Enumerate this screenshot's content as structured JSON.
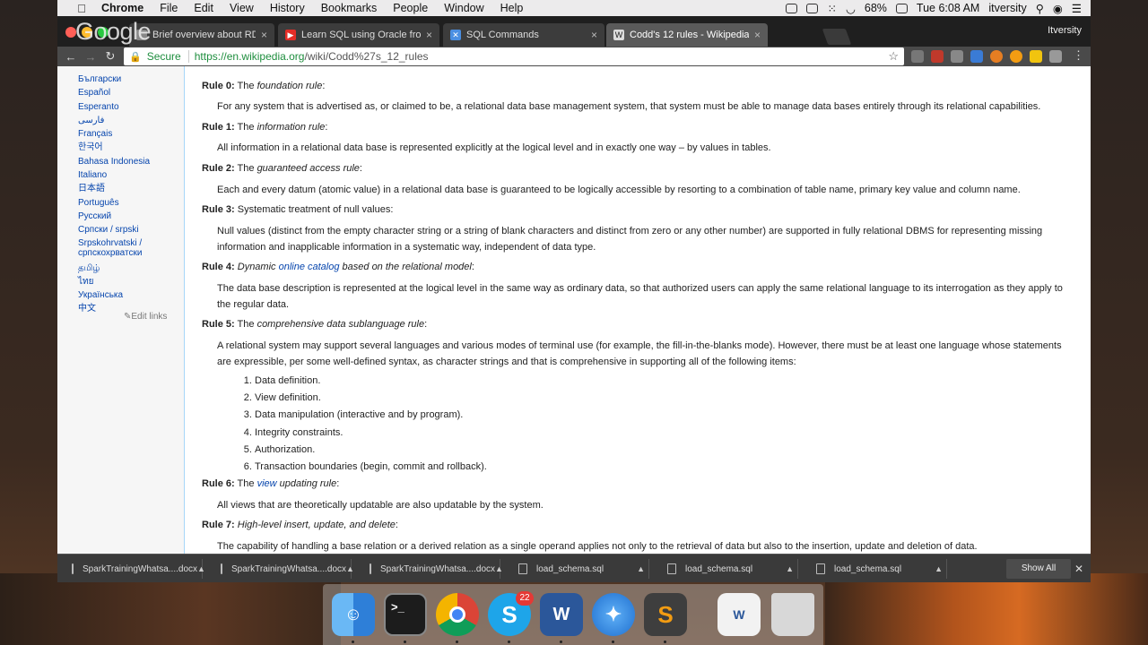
{
  "menubar": {
    "app": "Chrome",
    "items": [
      "File",
      "Edit",
      "View",
      "History",
      "Bookmarks",
      "People",
      "Window",
      "Help"
    ],
    "battery": "68%",
    "clock": "Tue 6:08 AM",
    "user": "itversity"
  },
  "browser": {
    "logo": "Google",
    "profile": "Itversity",
    "tabs": [
      {
        "label": "Brief overview about RDBMS,",
        "icon": "document-icon",
        "color": "#888888"
      },
      {
        "label": "Learn SQL using Oracle from c",
        "icon": "youtube-icon",
        "color": "#e52d27"
      },
      {
        "label": "SQL Commands",
        "icon": "tool-icon",
        "color": "#4a8fe2"
      },
      {
        "label": "Codd's 12 rules - Wikipedia",
        "icon": "wikipedia-icon",
        "color": "#dddddd"
      }
    ],
    "secure_label": "Secure",
    "url_host": "https://en.wikipedia.org",
    "url_path": "/wiki/Codd%27s_12_rules"
  },
  "sidebar": {
    "languages": [
      "Български",
      "Español",
      "Esperanto",
      "فارسی",
      "Français",
      "한국어",
      "Bahasa Indonesia",
      "Italiano",
      "日本語",
      "Português",
      "Русский",
      "Српски / srpski",
      "Srpskohrvatski / српскохрватски",
      "தமிழ்",
      "ไทย",
      "Українська",
      "中文"
    ],
    "edit_links": "Edit links"
  },
  "content": {
    "rule0": {
      "num": "Rule 0:",
      "pre": "The ",
      "name": "foundation rule",
      "post": ":",
      "desc": "For any system that is advertised as, or claimed to be, a relational data base management system, that system must be able to manage data bases entirely through its relational capabilities."
    },
    "rule1": {
      "num": "Rule 1:",
      "pre": "The ",
      "name": "information rule",
      "post": ":",
      "desc": "All information in a relational data base is represented explicitly at the logical level and in exactly one way – by values in tables."
    },
    "rule2": {
      "num": "Rule 2:",
      "pre": "The ",
      "name": "guaranteed access rule",
      "post": ":",
      "desc": "Each and every datum (atomic value) in a relational data base is guaranteed to be logically accessible by resorting to a combination of table name, primary key value and column name."
    },
    "rule3": {
      "num": "Rule 3:",
      "text": "Systematic treatment of null values:",
      "desc": "Null values (distinct from the empty character string or a string of blank characters and distinct from zero or any other number) are supported in fully relational DBMS for representing missing information and inapplicable information in a systematic way, independent of data type."
    },
    "rule4": {
      "num": "Rule 4:",
      "pre": "Dynamic ",
      "link": "online catalog",
      "post": " based on the relational model",
      "desc": "The data base description is represented at the logical level in the same way as ordinary data, so that authorized users can apply the same relational language to its interrogation as they apply to the regular data."
    },
    "rule5": {
      "num": "Rule 5:",
      "pre": "The ",
      "name": "comprehensive data sublanguage rule",
      "post": ":",
      "desc": "A relational system may support several languages and various modes of terminal use (for example, the fill-in-the-blanks mode). However, there must be at least one language whose statements are expressible, per some well-defined syntax, as character strings and that is comprehensive in supporting all of the following items:",
      "items": [
        "Data definition.",
        "View definition.",
        "Data manipulation (interactive and by program).",
        "Integrity constraints.",
        "Authorization.",
        "Transaction boundaries (begin, commit and rollback)."
      ]
    },
    "rule6": {
      "num": "Rule 6:",
      "pre": "The ",
      "link": "view",
      "name": " updating rule",
      "post": ":",
      "desc": "All views that are theoretically updatable are also updatable by the system."
    },
    "rule7": {
      "num": "Rule 7:",
      "name": "High-level insert, update, and delete",
      "post": ":",
      "desc": "The capability of handling a base relation or a derived relation as a single operand applies not only to the retrieval of data but also to the insertion, update and deletion of data."
    }
  },
  "downloads": {
    "files": [
      "SparkTrainingWhatsa....docx",
      "SparkTrainingWhatsa....docx",
      "SparkTrainingWhatsa....docx",
      "load_schema.sql",
      "load_schema.sql",
      "load_schema.sql"
    ],
    "show_all": "Show All"
  },
  "dock": {
    "apps": [
      {
        "name": "finder-icon",
        "color": "#3d8fe0"
      },
      {
        "name": "terminal-icon",
        "color": "#1c1c1c"
      },
      {
        "name": "chrome-icon",
        "color": "#ffffff"
      },
      {
        "name": "skype-icon",
        "color": "#1ea5e9"
      },
      {
        "name": "word-icon",
        "color": "#2b579a"
      },
      {
        "name": "safari-icon",
        "color": "#2f86df"
      },
      {
        "name": "sublime-icon",
        "color": "#4a4a4a"
      },
      {
        "name": "word-document-icon",
        "color": "#f2f2f2"
      },
      {
        "name": "trash-icon",
        "color": "#d8d8d8"
      }
    ],
    "skype_badge": "22"
  }
}
